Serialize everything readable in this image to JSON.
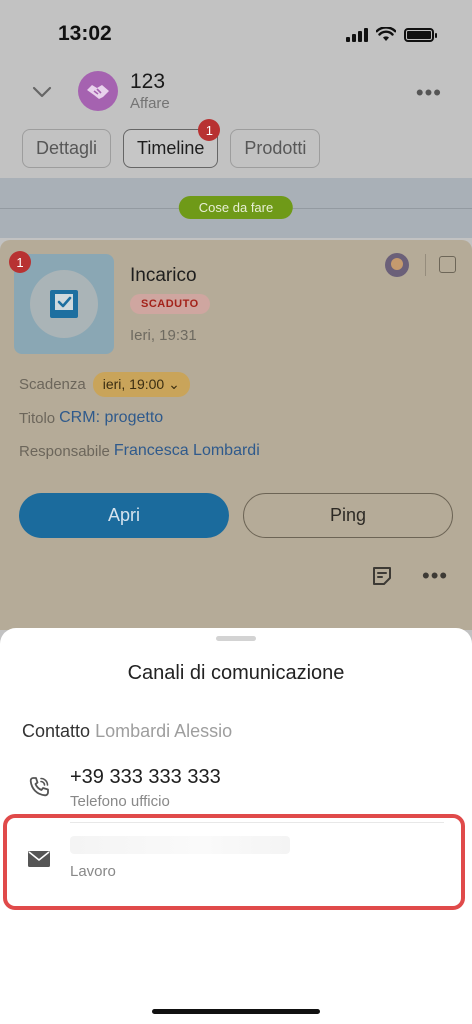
{
  "status_bar": {
    "time": "13:02"
  },
  "header": {
    "title": "123",
    "subtitle": "Affare",
    "deal_color": "#a562b0"
  },
  "tabs": [
    {
      "label": "Dettagli",
      "active": false
    },
    {
      "label": "Timeline",
      "active": true,
      "badge": "1"
    },
    {
      "label": "Prodotti",
      "active": false
    }
  ],
  "timeline": {
    "section_label": "Cose da fare"
  },
  "activity": {
    "badge": "1",
    "title": "Incarico",
    "status": "SCADUTO",
    "timestamp": "Ieri, 19:31",
    "deadline_label": "Scadenza",
    "deadline_value": "ieri, 19:00",
    "title_label": "Titolo",
    "title_value": "CRM: progetto",
    "responsible_label": "Responsabile",
    "responsible_value": "Francesca Lombardi",
    "open_button": "Apri",
    "ping_button": "Ping"
  },
  "sheet": {
    "title": "Canali di comunicazione",
    "contact_label": "Contatto",
    "contact_name": "Lombardi Alessio",
    "phone_number": "+39 333 333 333",
    "phone_type": "Telefono ufficio",
    "email_type": "Lavoro",
    "highlight_color": "#e04a4a"
  }
}
